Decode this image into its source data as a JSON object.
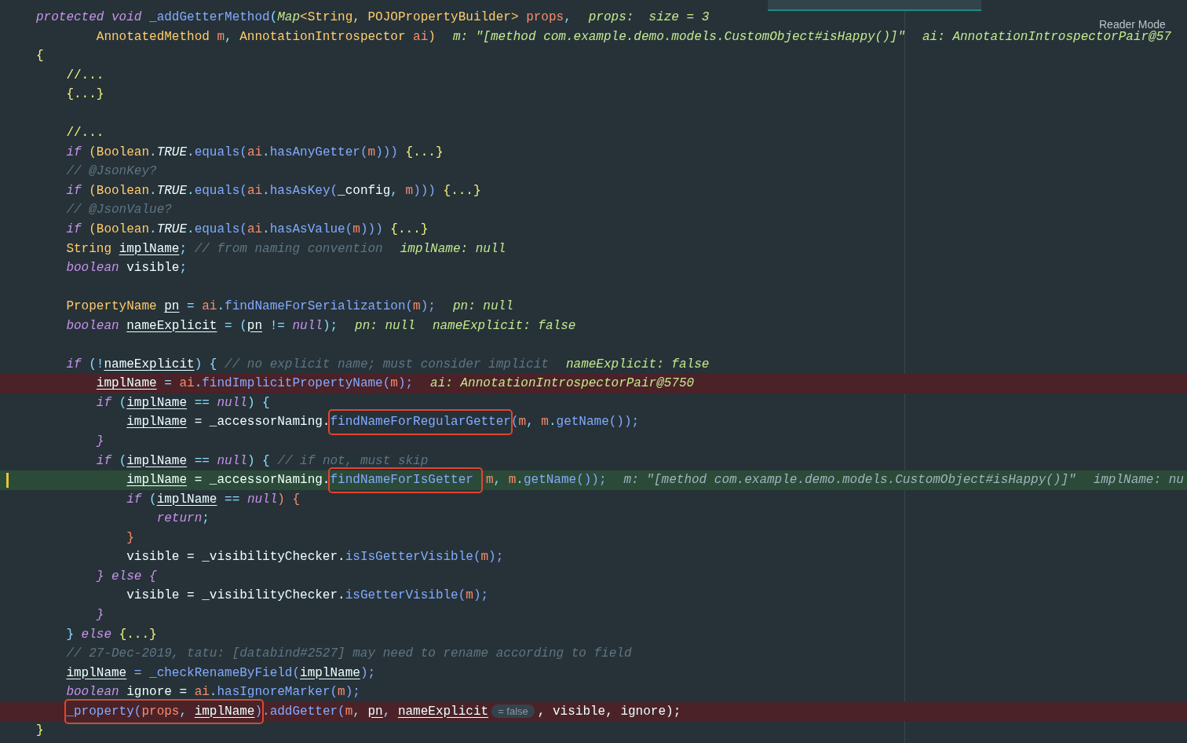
{
  "toolbar": {
    "reader_mode": "Reader Mode"
  },
  "lines": [
    {
      "kind": "normal",
      "tokens": [
        {
          "text": "protected void ",
          "kind": "kw"
        },
        {
          "text": "_addGetterMethod",
          "kind": "fn"
        },
        {
          "text": "(",
          "kind": "p"
        },
        {
          "text": "Map",
          "kind": "typei"
        },
        {
          "text": "<String, POJOPropertyBuilder> ",
          "kind": "type"
        },
        {
          "text": "props",
          "kind": "param"
        },
        {
          "text": ",",
          "kind": "p"
        },
        {
          "text": "props:  size = 3",
          "kind": "hint"
        }
      ]
    },
    {
      "kind": "normal",
      "tokens": [
        {
          "text": "        AnnotatedMethod ",
          "kind": "type"
        },
        {
          "text": "m",
          "kind": "param"
        },
        {
          "text": ", ",
          "kind": "p"
        },
        {
          "text": "AnnotationIntrospector ",
          "kind": "type"
        },
        {
          "text": "ai",
          "kind": "param"
        },
        {
          "text": ")",
          "kind": "type"
        },
        {
          "text": "m: \"[method com.example.demo.models.CustomObject#isHappy()]\"",
          "kind": "hint"
        },
        {
          "text": "ai: AnnotationIntrospectorPair@57",
          "kind": "hint"
        }
      ]
    },
    {
      "kind": "normal",
      "tokens": [
        {
          "text": "{",
          "kind": "fold"
        }
      ]
    },
    {
      "kind": "normal",
      "tokens": [
        {
          "text": "    //...",
          "kind": "fold"
        }
      ]
    },
    {
      "kind": "normal",
      "tokens": [
        {
          "text": "    {...}",
          "kind": "fold"
        }
      ]
    },
    {
      "kind": "blank"
    },
    {
      "kind": "normal",
      "tokens": [
        {
          "text": "    //...",
          "kind": "fold"
        }
      ]
    },
    {
      "kind": "normal",
      "tokens": [
        {
          "text": "    if ",
          "kind": "kw"
        },
        {
          "text": "(Boolean",
          "kind": "type"
        },
        {
          "text": ".",
          "kind": "p"
        },
        {
          "text": "TRUE",
          "kind": "const"
        },
        {
          "text": ".",
          "kind": "p"
        },
        {
          "text": "equals",
          "kind": "fn"
        },
        {
          "text": "(",
          "kind": "fn"
        },
        {
          "text": "ai",
          "kind": "param"
        },
        {
          "text": ".",
          "kind": "p"
        },
        {
          "text": "hasAnyGetter(",
          "kind": "fn"
        },
        {
          "text": "m",
          "kind": "param"
        },
        {
          "text": ")))",
          "kind": "fn"
        },
        {
          "text": " {...}",
          "kind": "fold"
        }
      ]
    },
    {
      "kind": "normal",
      "tokens": [
        {
          "text": "    // @JsonKey?",
          "kind": "c"
        }
      ]
    },
    {
      "kind": "normal",
      "tokens": [
        {
          "text": "    if ",
          "kind": "kw"
        },
        {
          "text": "(Boolean",
          "kind": "type"
        },
        {
          "text": ".",
          "kind": "p"
        },
        {
          "text": "TRUE",
          "kind": "const"
        },
        {
          "text": ".",
          "kind": "p"
        },
        {
          "text": "equals",
          "kind": "fn"
        },
        {
          "text": "(",
          "kind": "fn"
        },
        {
          "text": "ai",
          "kind": "param"
        },
        {
          "text": ".",
          "kind": "p"
        },
        {
          "text": "hasAsKey(",
          "kind": "fn"
        },
        {
          "text": "_config",
          "kind": "t"
        },
        {
          "text": ", ",
          "kind": "p"
        },
        {
          "text": "m",
          "kind": "param"
        },
        {
          "text": ")))",
          "kind": "fn"
        },
        {
          "text": " {...}",
          "kind": "fold"
        }
      ]
    },
    {
      "kind": "normal",
      "tokens": [
        {
          "text": "    // @JsonValue?",
          "kind": "c"
        }
      ]
    },
    {
      "kind": "normal",
      "tokens": [
        {
          "text": "    if ",
          "kind": "kw"
        },
        {
          "text": "(Boolean",
          "kind": "type"
        },
        {
          "text": ".",
          "kind": "p"
        },
        {
          "text": "TRUE",
          "kind": "const"
        },
        {
          "text": ".",
          "kind": "p"
        },
        {
          "text": "equals",
          "kind": "fn"
        },
        {
          "text": "(",
          "kind": "fn"
        },
        {
          "text": "ai",
          "kind": "param"
        },
        {
          "text": ".",
          "kind": "p"
        },
        {
          "text": "hasAsValue(",
          "kind": "fn"
        },
        {
          "text": "m",
          "kind": "param"
        },
        {
          "text": ")))",
          "kind": "fn"
        },
        {
          "text": " {...}",
          "kind": "fold"
        }
      ]
    },
    {
      "kind": "normal",
      "tokens": [
        {
          "text": "    String ",
          "kind": "type"
        },
        {
          "text": "implName",
          "kind": "ul"
        },
        {
          "text": "; ",
          "kind": "p"
        },
        {
          "text": "// from naming convention",
          "kind": "c"
        },
        {
          "text": "implName: null",
          "kind": "hint"
        }
      ]
    },
    {
      "kind": "normal",
      "tokens": [
        {
          "text": "    boolean ",
          "kind": "kw"
        },
        {
          "text": "visible",
          "kind": "t"
        },
        {
          "text": ";",
          "kind": "p"
        }
      ]
    },
    {
      "kind": "blank"
    },
    {
      "kind": "normal",
      "tokens": [
        {
          "text": "    PropertyName ",
          "kind": "type"
        },
        {
          "text": "pn",
          "kind": "ul"
        },
        {
          "text": " = ",
          "kind": "p"
        },
        {
          "text": "ai",
          "kind": "param"
        },
        {
          "text": ".",
          "kind": "p"
        },
        {
          "text": "findNameForSerialization(",
          "kind": "fn"
        },
        {
          "text": "m",
          "kind": "param"
        },
        {
          "text": ");",
          "kind": "fn"
        },
        {
          "text": "pn: null",
          "kind": "hint"
        }
      ]
    },
    {
      "kind": "normal",
      "tokens": [
        {
          "text": "    boolean ",
          "kind": "kw"
        },
        {
          "text": "nameExplicit",
          "kind": "ul"
        },
        {
          "text": " = (",
          "kind": "p"
        },
        {
          "text": "pn",
          "kind": "ul"
        },
        {
          "text": " != ",
          "kind": "p"
        },
        {
          "text": "null",
          "kind": "kw"
        },
        {
          "text": ");",
          "kind": "p"
        },
        {
          "text": "pn: null",
          "kind": "hint"
        },
        {
          "text": "nameExplicit: false",
          "kind": "hint"
        }
      ]
    },
    {
      "kind": "blank"
    },
    {
      "kind": "normal",
      "tokens": [
        {
          "text": "    if ",
          "kind": "kw"
        },
        {
          "text": "(!",
          "kind": "p"
        },
        {
          "text": "nameExplicit",
          "kind": "ul"
        },
        {
          "text": ") { ",
          "kind": "p"
        },
        {
          "text": "// no explicit name; must consider implicit",
          "kind": "c"
        },
        {
          "text": "nameExplicit: false",
          "kind": "hint"
        }
      ]
    },
    {
      "kind": "breakpoint",
      "tokens": [
        {
          "text": "        implName",
          "kind": "ul"
        },
        {
          "text": " = ",
          "kind": "p"
        },
        {
          "text": "ai",
          "kind": "param"
        },
        {
          "text": ".",
          "kind": "p"
        },
        {
          "text": "findImplicitPropertyName(",
          "kind": "fn"
        },
        {
          "text": "m",
          "kind": "param"
        },
        {
          "text": ");",
          "kind": "fn"
        },
        {
          "text": "ai: AnnotationIntrospectorPair@5750",
          "kind": "hint"
        }
      ]
    },
    {
      "kind": "normal",
      "tokens": [
        {
          "text": "        if ",
          "kind": "kw"
        },
        {
          "text": "(",
          "kind": "p"
        },
        {
          "text": "implName",
          "kind": "ul"
        },
        {
          "text": " == ",
          "kind": "p"
        },
        {
          "text": "null",
          "kind": "kw"
        },
        {
          "text": ") {",
          "kind": "p"
        }
      ]
    },
    {
      "kind": "normal",
      "tokens": [
        {
          "text": "            implName",
          "kind": "ul"
        },
        {
          "text": " = _accessorNaming.",
          "kind": "t"
        },
        {
          "kind": "box",
          "tokens": [
            {
              "text": "findNameForRegularGetter",
              "kind": "fn"
            }
          ]
        },
        {
          "text": "(",
          "kind": "fn"
        },
        {
          "text": "m",
          "kind": "param"
        },
        {
          "text": ", ",
          "kind": "p"
        },
        {
          "text": "m",
          "kind": "param"
        },
        {
          "text": ".",
          "kind": "p"
        },
        {
          "text": "getName());",
          "kind": "fn"
        }
      ]
    },
    {
      "kind": "normal",
      "tokens": [
        {
          "text": "        }",
          "kind": "kw"
        }
      ]
    },
    {
      "kind": "normal",
      "tokens": [
        {
          "text": "        if ",
          "kind": "kw"
        },
        {
          "text": "(",
          "kind": "p"
        },
        {
          "text": "implName",
          "kind": "ul"
        },
        {
          "text": " == ",
          "kind": "p"
        },
        {
          "text": "null",
          "kind": "kw"
        },
        {
          "text": ") { ",
          "kind": "p"
        },
        {
          "text": "// if not, must skip",
          "kind": "c"
        }
      ]
    },
    {
      "kind": "current",
      "tokens": [
        {
          "text": "            implName",
          "kind": "ul"
        },
        {
          "text": " = _accessorNaming.",
          "kind": "t"
        },
        {
          "kind": "box",
          "tokens": [
            {
              "text": "findNameForIsGetter",
              "kind": "fn"
            }
          ]
        },
        {
          "text": "m",
          "kind": "param"
        },
        {
          "text": ", ",
          "kind": "p"
        },
        {
          "text": "m",
          "kind": "param"
        },
        {
          "text": ".",
          "kind": "p"
        },
        {
          "text": "getName());",
          "kind": "fn"
        },
        {
          "text": "m: \"[method com.example.demo.models.CustomObject#isHappy()]\"",
          "kind": "hintg"
        },
        {
          "text": "implName: nu",
          "kind": "hintg"
        }
      ]
    },
    {
      "kind": "normal",
      "tokens": [
        {
          "text": "            if ",
          "kind": "kw"
        },
        {
          "text": "(",
          "kind": "p"
        },
        {
          "text": "implName",
          "kind": "ul"
        },
        {
          "text": " == ",
          "kind": "p"
        },
        {
          "text": "null",
          "kind": "kw"
        },
        {
          "text": ") {",
          "kind": "param"
        }
      ]
    },
    {
      "kind": "normal",
      "tokens": [
        {
          "text": "                return",
          "kind": "kw"
        },
        {
          "text": ";",
          "kind": "p"
        }
      ]
    },
    {
      "kind": "normal",
      "tokens": [
        {
          "text": "            }",
          "kind": "param"
        }
      ]
    },
    {
      "kind": "normal",
      "tokens": [
        {
          "text": "            visible = _visibilityChecker.",
          "kind": "t"
        },
        {
          "text": "isIsGetterVisible(",
          "kind": "fn"
        },
        {
          "text": "m",
          "kind": "param"
        },
        {
          "text": ");",
          "kind": "fn"
        }
      ]
    },
    {
      "kind": "normal",
      "tokens": [
        {
          "text": "        } else {",
          "kind": "kw"
        }
      ]
    },
    {
      "kind": "normal",
      "tokens": [
        {
          "text": "            visible = _visibilityChecker.",
          "kind": "t"
        },
        {
          "text": "isGetterVisible(",
          "kind": "fn"
        },
        {
          "text": "m",
          "kind": "param"
        },
        {
          "text": ");",
          "kind": "fn"
        }
      ]
    },
    {
      "kind": "normal",
      "tokens": [
        {
          "text": "        }",
          "kind": "kw"
        }
      ]
    },
    {
      "kind": "normal",
      "tokens": [
        {
          "text": "    } ",
          "kind": "p"
        },
        {
          "text": "else ",
          "kind": "kw"
        },
        {
          "text": "{...}",
          "kind": "fold"
        }
      ]
    },
    {
      "kind": "normal",
      "tokens": [
        {
          "text": "    // 27-Dec-2019, tatu: [databind#2527] may need to rename according to field",
          "kind": "c"
        }
      ]
    },
    {
      "kind": "normal",
      "tokens": [
        {
          "text": "    implName",
          "kind": "ul"
        },
        {
          "text": " = _checkRenameByField(",
          "kind": "fn"
        },
        {
          "text": "implName",
          "kind": "ul"
        },
        {
          "text": ");",
          "kind": "fn"
        }
      ]
    },
    {
      "kind": "normal",
      "tokens": [
        {
          "text": "    boolean ",
          "kind": "kw"
        },
        {
          "text": "ignore = ",
          "kind": "t"
        },
        {
          "text": "ai",
          "kind": "param"
        },
        {
          "text": ".",
          "kind": "p"
        },
        {
          "text": "hasIgnoreMarker(",
          "kind": "fn"
        },
        {
          "text": "m",
          "kind": "param"
        },
        {
          "text": ");",
          "kind": "fn"
        }
      ]
    },
    {
      "kind": "breakpoint",
      "tokens": [
        {
          "kind": "box",
          "tokens": [
            {
              "text": "    _property(",
              "kind": "fn"
            },
            {
              "text": "props",
              "kind": "param"
            },
            {
              "text": ", ",
              "kind": "p"
            },
            {
              "text": "implName",
              "kind": "ul"
            },
            {
              "text": ")",
              "kind": "fn"
            }
          ]
        },
        {
          "text": ".addGetter(",
          "kind": "fn"
        },
        {
          "text": "m",
          "kind": "param"
        },
        {
          "text": ", ",
          "kind": "p"
        },
        {
          "text": "pn",
          "kind": "ul"
        },
        {
          "text": ", ",
          "kind": "p"
        },
        {
          "text": "nameExplicit",
          "kind": "ul"
        },
        {
          "text": "= false",
          "kind": "chip"
        },
        {
          "text": ", visible, ignore);",
          "kind": "t"
        }
      ]
    },
    {
      "kind": "normal",
      "tokens": [
        {
          "text": "}",
          "kind": "fold"
        }
      ]
    }
  ]
}
